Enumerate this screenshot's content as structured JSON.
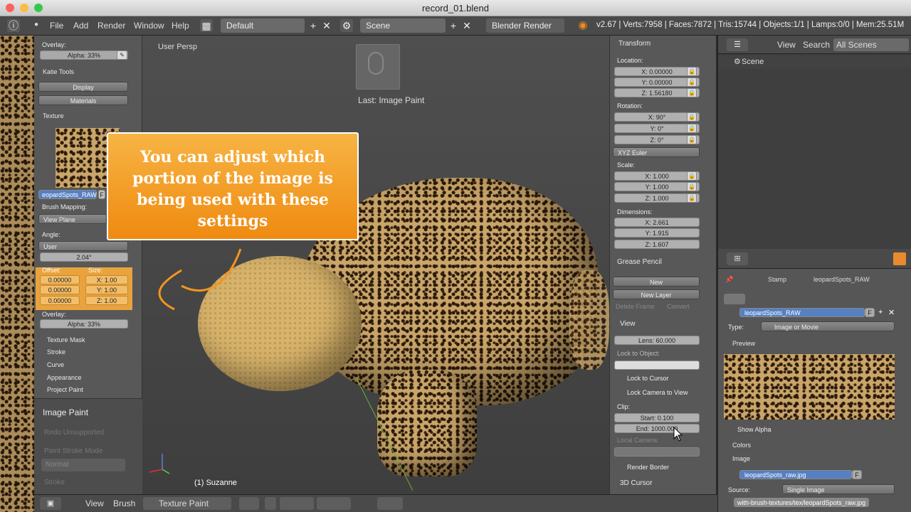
{
  "window": {
    "title": "record_01.blend"
  },
  "infobar": {
    "menus": [
      "File",
      "Add",
      "Render",
      "Window",
      "Help"
    ],
    "screen_layout": "Default",
    "scene": "Scene",
    "render_engine": "Blender Render",
    "stats": "v2.67 | Verts:7958 | Faces:7872 | Tris:15744 | Objects:1/1 | Lamps:0/0 | Mem:25.51M"
  },
  "toolshelf": {
    "overlay_label": "Overlay:",
    "alpha_top": "Alpha: 33%",
    "katie_tools": "Katie Tools",
    "display_btn": "Display",
    "materials_btn": "Materials",
    "texture_header": "Texture",
    "texture_name": "eopardSpots_RAW",
    "texture_f": "F",
    "brush_mapping_label": "Brush Mapping:",
    "brush_mapping_value": "View Plane",
    "angle_label": "Angle:",
    "angle_mode": "User",
    "angle_value": "2.04°",
    "offset_label": "Offset:",
    "size_label": "Size:",
    "offset_values": [
      "0.00000",
      "0.00000",
      "0.00000"
    ],
    "size_values": [
      "X: 1.00",
      "Y: 1.00",
      "Z: 1.00"
    ],
    "overlay_label2": "Overlay:",
    "alpha_bottom": "Alpha: 33%",
    "sections": [
      "Texture Mask",
      "Stroke",
      "Curve",
      "Appearance",
      "Project Paint"
    ],
    "operator_title": "Image Paint",
    "redo": "Redo Unsupported",
    "paint_stroke_mode": "Paint Stroke Mode",
    "normal": "Normal",
    "stroke": "Stroke"
  },
  "viewport": {
    "view_label": "User Persp",
    "last_op": "Last: Image Paint",
    "object_label": "(1) Suzanne",
    "callout": "You can adjust which portion of the image is being used with these settings"
  },
  "npanel": {
    "transform": "Transform",
    "location_label": "Location:",
    "location": [
      "X: 0.00000",
      "Y: 0.00000",
      "Z: 1.56180"
    ],
    "rotation_label": "Rotation:",
    "rotation": [
      "X: 90°",
      "Y: 0°",
      "Z: 0°"
    ],
    "rotation_mode": "XYZ Euler",
    "scale_label": "Scale:",
    "scale": [
      "X: 1.000",
      "Y: 1.000",
      "Z: 1.000"
    ],
    "dimensions_label": "Dimensions:",
    "dimensions": [
      "X: 2.661",
      "Y: 1.915",
      "Z: 1.607"
    ],
    "grease_pencil": "Grease Pencil",
    "new_btn": "New",
    "new_layer_btn": "New Layer",
    "delete_frame": "Delete Frame",
    "convert": "Convert",
    "view": "View",
    "lens": "Lens: 60.000",
    "lock_to_object": "Lock to Object:",
    "lock_to_cursor": "Lock to Cursor",
    "lock_camera": "Lock Camera to View",
    "clip_label": "Clip:",
    "clip_start": "Start: 0.100",
    "clip_end": "End: 1000.000",
    "local_camera": "Local Camera:",
    "render_border": "Render Border",
    "cursor_3d": "3D Cursor"
  },
  "outliner": {
    "view": "View",
    "search": "Search",
    "filter": "All Scenes",
    "scene_item": "Scene"
  },
  "properties": {
    "stamp": "Stamp",
    "texture_crumb": "leopardSpots_RAW",
    "texture_name": "leopardSpots_RAW",
    "f_label": "F",
    "type_label": "Type:",
    "type_value": "Image or Movie",
    "preview": "Preview",
    "show_alpha": "Show Alpha",
    "colors": "Colors",
    "image": "Image",
    "image_name": "leopardSpots_raw.jpg",
    "source_label": "Source:",
    "source_value": "Single Image",
    "filepath": "with-brush-textures/tex/leopardSpots_raw.jpg"
  },
  "bottombar": {
    "view": "View",
    "brush": "Brush",
    "mode": "Texture Paint"
  },
  "colors": {
    "orange_callout": "#f39c12",
    "highlight_orange": "#e8a33d",
    "selected_blue": "#5680c2"
  }
}
